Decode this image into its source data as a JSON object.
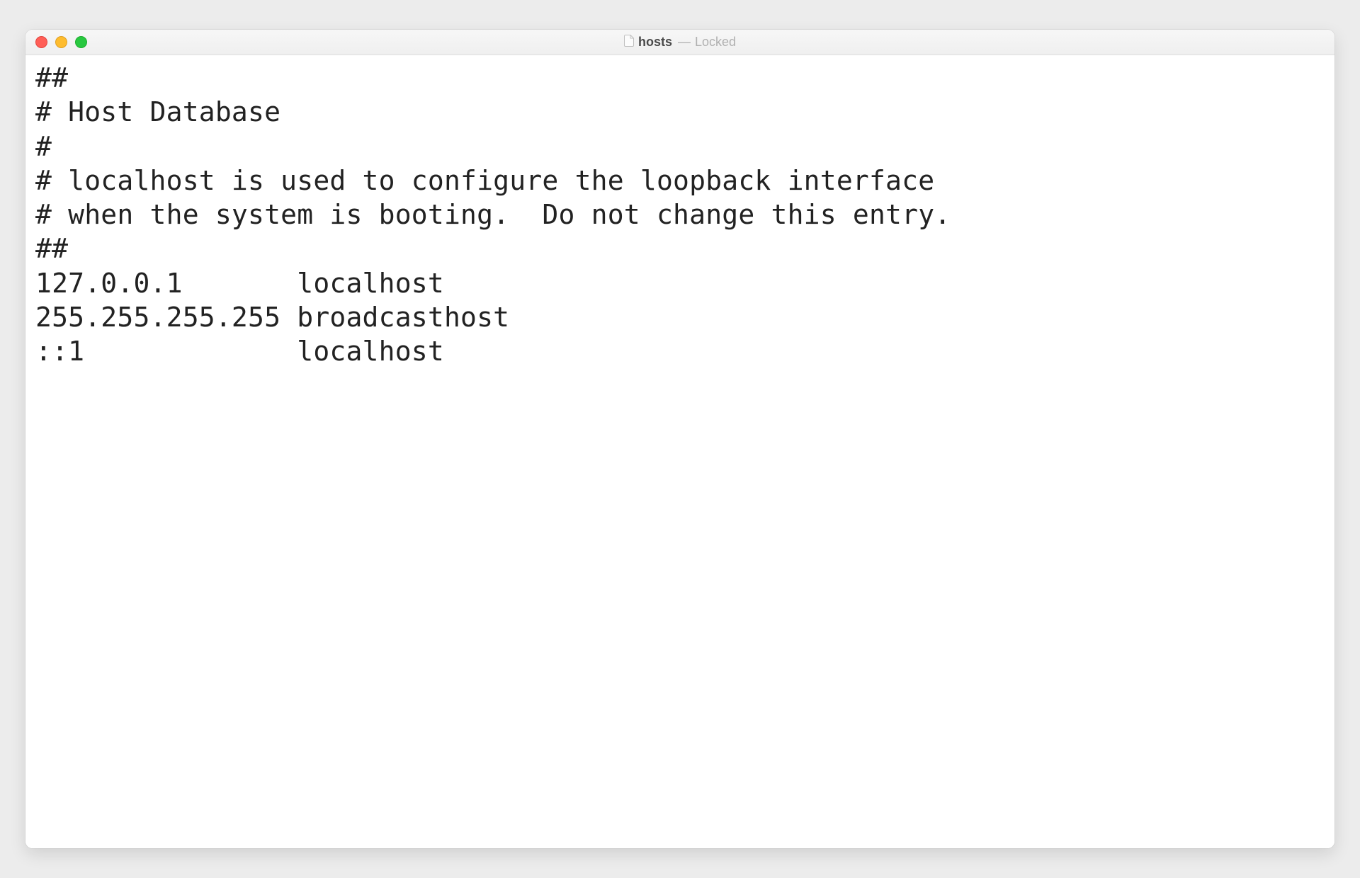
{
  "titlebar": {
    "filename": "hosts",
    "dash": "—",
    "status": "Locked"
  },
  "content": "##\n# Host Database\n#\n# localhost is used to configure the loopback interface\n# when the system is booting.  Do not change this entry.\n##\n127.0.0.1       localhost\n255.255.255.255 broadcasthost\n::1             localhost"
}
